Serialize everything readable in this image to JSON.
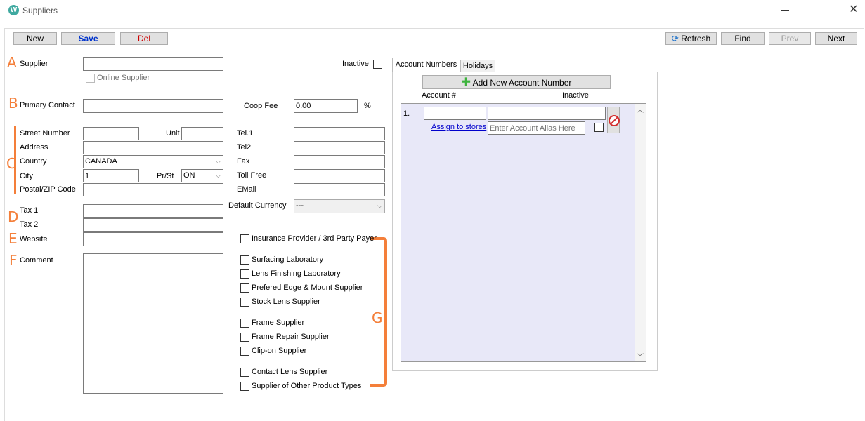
{
  "window": {
    "title": "Suppliers"
  },
  "toolbar": {
    "new": "New",
    "save": "Save",
    "del": "Del",
    "refresh": "Refresh",
    "find": "Find",
    "prev": "Prev",
    "next": "Next"
  },
  "markers": {
    "a": "A",
    "b": "B",
    "c": "C",
    "d": "D",
    "e": "E",
    "f": "F",
    "g": "G"
  },
  "form": {
    "supplier_label": "Supplier",
    "supplier_value": "",
    "online_supplier": "Online Supplier",
    "inactive_label": "Inactive",
    "primary_contact_label": "Primary Contact",
    "coop_fee_label": "Coop Fee",
    "coop_fee_value": "0.00",
    "percent": "%",
    "street_number_label": "Street Number",
    "unit_label": "Unit",
    "address_label": "Address",
    "country_label": "Country",
    "country_value": "CANADA",
    "city_label": "City",
    "city_value": "1",
    "prst_label": "Pr/St",
    "prst_value": "ON",
    "postal_label": "Postal/ZIP Code",
    "tel1_label": "Tel.1",
    "tel2_label": "Tel2",
    "fax_label": "Fax",
    "tollfree_label": "Toll Free",
    "email_label": "EMail",
    "default_currency_label": "Default Currency",
    "default_currency_value": "---",
    "tax1_label": "Tax 1",
    "tax2_label": "Tax 2",
    "website_label": "Website",
    "comment_label": "Comment"
  },
  "supplier_types": [
    "Insurance Provider / 3rd Party Payer",
    "Surfacing Laboratory",
    "Lens Finishing Laboratory",
    "Prefered Edge & Mount Supplier",
    "Stock Lens Supplier",
    "Frame Supplier",
    "Frame Repair Supplier",
    "Clip-on Supplier",
    "Contact Lens Supplier",
    "Supplier of Other Product Types"
  ],
  "accounts_panel": {
    "tabs": [
      "Account Numbers",
      "Holidays"
    ],
    "add_button": "Add New Account Number",
    "col_account": "Account #",
    "col_inactive": "Inactive",
    "row_index": "1.",
    "assign_link": "Assign to stores",
    "alias_placeholder": "Enter Account Alias Here"
  },
  "colors": {
    "accent_marker": "#f47f3a",
    "link": "#0000cc",
    "save_text": "#0033cc",
    "del_text": "#cc0000"
  }
}
